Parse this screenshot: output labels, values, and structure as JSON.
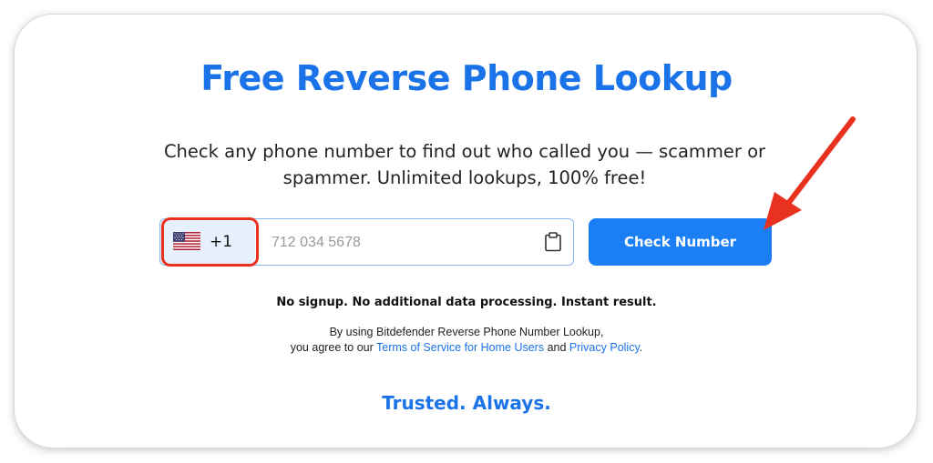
{
  "page": {
    "title": "Free Reverse Phone Lookup",
    "subtitle_line1": "Check any phone number to find out who called you — scammer or",
    "subtitle_line2": "spammer. Unlimited lookups, 100% free!"
  },
  "form": {
    "country_code": "+1",
    "country_flag_icon": "us-flag-icon",
    "phone_placeholder": "712 034 5678",
    "phone_value": "",
    "paste_icon": "clipboard-icon",
    "submit_label": "Check Number"
  },
  "note": "No signup. No additional data processing. Instant result.",
  "legal": {
    "line1": "By using Bitdefender Reverse Phone Number Lookup,",
    "line2_prefix": "you agree to our ",
    "terms_link": "Terms of Service for Home Users",
    "conjunction": " and ",
    "privacy_link": "Privacy Policy",
    "line2_suffix": "."
  },
  "tagline": "Trusted. Always.",
  "colors": {
    "brand_blue": "#1a73e8",
    "button_blue": "#1a7ef5",
    "highlight_red": "#e8321f"
  }
}
